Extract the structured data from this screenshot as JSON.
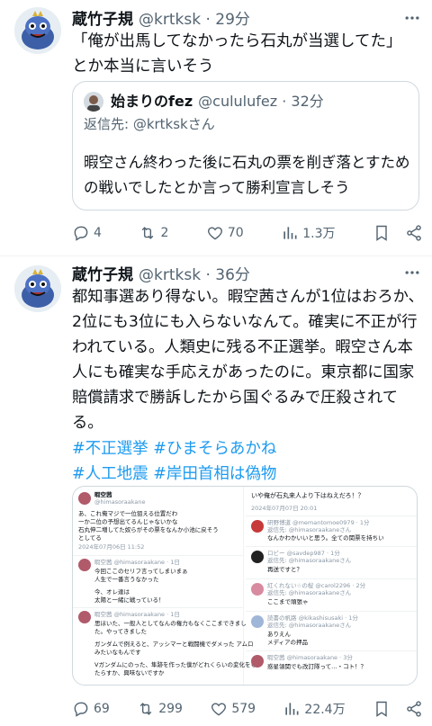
{
  "tweets": [
    {
      "author_name": "蔵竹子規",
      "author_handle": "@krtksk · 29分",
      "text": "「俺が出馬してなかったら石丸が当選してた」\nとか本当に言いそう",
      "quote": {
        "author_name": "始まりのfez",
        "author_handle": "@cululufez · 32分",
        "reply_to": "返信先: @krtkskさん",
        "text": "暇空さん終わった後に石丸の票を削ぎ落とすための戦いでしたとか言って勝利宣言しそう"
      },
      "actions": {
        "replies": "4",
        "retweets": "2",
        "likes": "70",
        "views": "1.3万"
      }
    },
    {
      "author_name": "蔵竹子規",
      "author_handle": "@krtksk · 36分",
      "text": "都知事選あり得ない。暇空茜さんが1位はおろか、2位にも3位にも入らないなんて。確実に不正が行われている。人類史に残る不正選挙。暇空さん本人にも確実な手応えがあったのに。東京都に国家賠償請求で勝訴したから国ぐるみで圧殺されてる。",
      "hashtags_line1": "#不正選挙 #ひまそらあかね",
      "hashtags_line2": "#人工地震 #岸田首相は偽物",
      "actions": {
        "replies": "69",
        "retweets": "299",
        "likes": "579",
        "views": "22.4万"
      }
    }
  ],
  "media": {
    "left": {
      "post_name": "暇空茜",
      "post_handle": "@himasoraakane",
      "post_text": "あ、これ俺マジで一位狙える位置だわ\n一か二位の予想出てるんじゃないかな\n石丸伸二増してた奴らがその票をなんか小池に戻そう\nとしてる",
      "post_date": "2024年07月06日 11:52",
      "r1_name": "暇空茜 @himasoraakane · 1日",
      "r1_text": "今回ここのセリフ言ってしまいまぁ\n人生で一番言うなかった",
      "r1_text2": "今、オレ達は\n太陽と一緒に戦っている！",
      "r2_name": "暇空茜 @himasoraakane · 1日",
      "r2_text": "思ほいた、一般人としてなんの権力もなくここまできまし\nた。やってきました",
      "r2_text2": "ガンダムで例えると、アッシマーと戦闘機でダメった アムロ\nみたいなもんです",
      "r2_text3": "Vガンダムにのった、隼跡を作った僕がどれくらいの変化をも\nたらすか、興味ないですか"
    },
    "right": {
      "title": "いや俺が石丸来人より下はねえだろ！？",
      "date": "2024年07月07日 20:01",
      "r1": "研野博道 @memantomoe0979 · 1分",
      "r1_to": "返信先: @himasoraakaneさん",
      "r1_text": "なんかわかいいと思う。全ての関票を持ちい",
      "r2": "ロビー @savdep987 · 1分",
      "r2_to": "返信先: @himasoraakaneさん",
      "r2_text": "再送ですと？",
      "r3": "紅くれない☆の桜 @carol2296 · 2分",
      "r3_to": "返信先: @himasoraakaneさん",
      "r3_text": "ここまで頑張ゃ",
      "r4": "読書の帆路 @kikashisusaki · 1分",
      "r4_to": "返信先: @himasoraakaneさん",
      "r4_text": "ありえん\nメディアの押品",
      "r5": "暇空茜 @himasoraakane · 3分",
      "r5_text": "惑星領関でも改訂隊って…・コト！？"
    }
  },
  "colors": {
    "accent": "#1d9bf0",
    "secondary_text": "#536471",
    "border": "#cfd9de"
  }
}
